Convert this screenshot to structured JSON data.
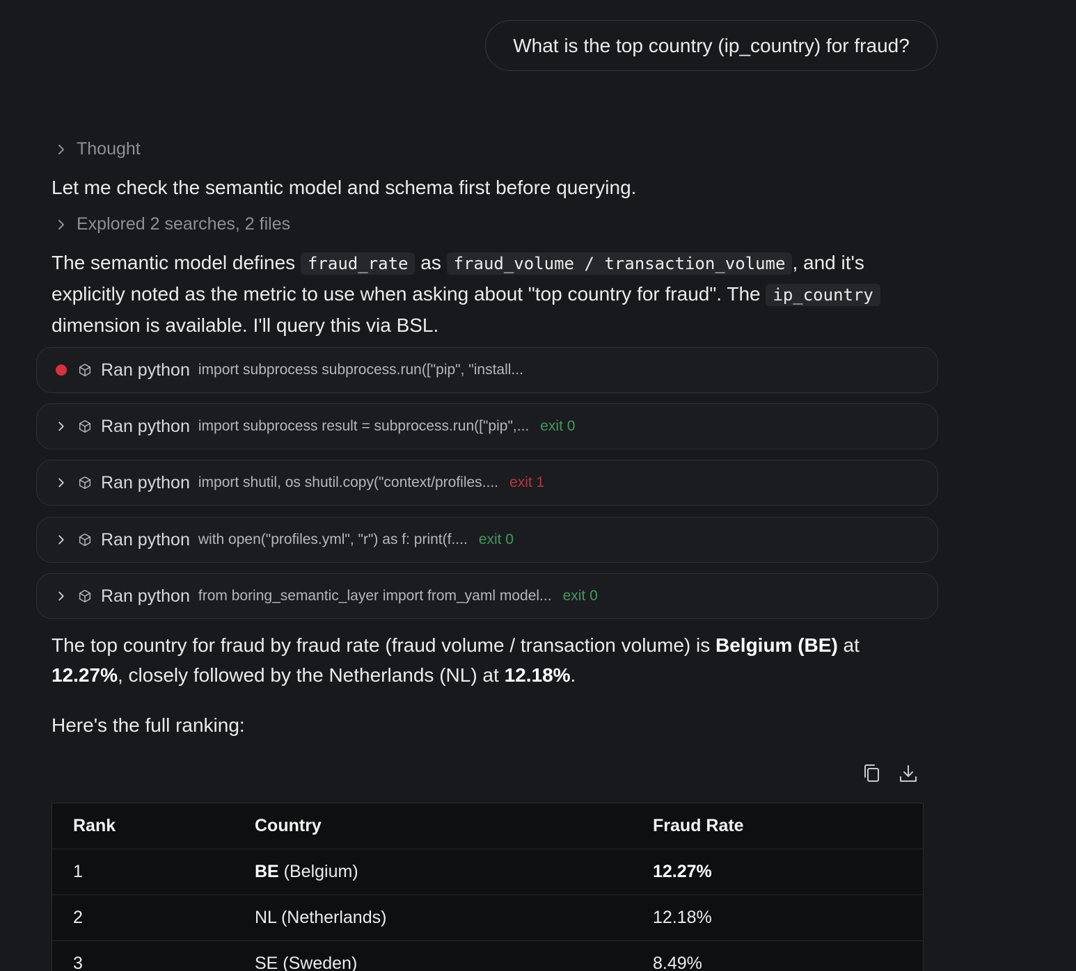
{
  "user_message": "What is the top country (ip_country) for fraud?",
  "thought_label": "Thought",
  "intro_text": "Let me check the semantic model and schema first before querying.",
  "explored_label": "Explored 2 searches, 2 files",
  "explanation": {
    "part1": "The semantic model defines ",
    "code1": "fraud_rate",
    "part2": " as ",
    "code2": "fraud_volume / transaction_volume",
    "part3": ", and it's explicitly noted as the metric to use when asking about \"top country for fraud\". The ",
    "code3": "ip_country",
    "part4": " dimension is available. I'll query this via BSL."
  },
  "tool_runs": [
    {
      "name": "Ran python",
      "snippet": "import subprocess subprocess.run([\"pip\", \"install...",
      "status": "",
      "running": true
    },
    {
      "name": "Ran python",
      "snippet": "import subprocess result = subprocess.run([\"pip\",...",
      "status": "exit 0",
      "running": false
    },
    {
      "name": "Ran python",
      "snippet": "import shutil, os shutil.copy(\"context/profiles....",
      "status": "exit 1",
      "running": false
    },
    {
      "name": "Ran python",
      "snippet": "with open(\"profiles.yml\", \"r\") as f: print(f....",
      "status": "exit 0",
      "running": false
    },
    {
      "name": "Ran python",
      "snippet": "from boring_semantic_layer import from_yaml model...",
      "status": "exit 0",
      "running": false
    }
  ],
  "result": {
    "part1": "The top country for fraud by fraud rate (fraud volume / transaction volume) is ",
    "bold1": "Belgium (BE)",
    "part2": " at ",
    "bold2": "12.27%",
    "part3": ", closely followed by the Netherlands (NL) at ",
    "bold3": "12.18%",
    "part4": "."
  },
  "ranking_intro": "Here's the full ranking:",
  "table": {
    "headers": [
      "Rank",
      "Country",
      "Fraud Rate"
    ],
    "rows": [
      {
        "rank": "1",
        "code": "BE",
        "country": " (Belgium)",
        "rate": "12.27%"
      },
      {
        "rank": "2",
        "code": "",
        "country": "NL (Netherlands)",
        "rate": "12.18%"
      },
      {
        "rank": "3",
        "code": "",
        "country": "SE (Sweden)",
        "rate": "8.49%"
      }
    ]
  },
  "colors": {
    "background": "#18191c",
    "running_dot": "#d8313a",
    "exit_success": "#3f9b5c",
    "exit_failure": "#b3383f"
  },
  "icons": {
    "chevron": "chevron-right-icon",
    "tool": "cube-icon",
    "copy": "copy-icon",
    "download": "download-icon"
  }
}
